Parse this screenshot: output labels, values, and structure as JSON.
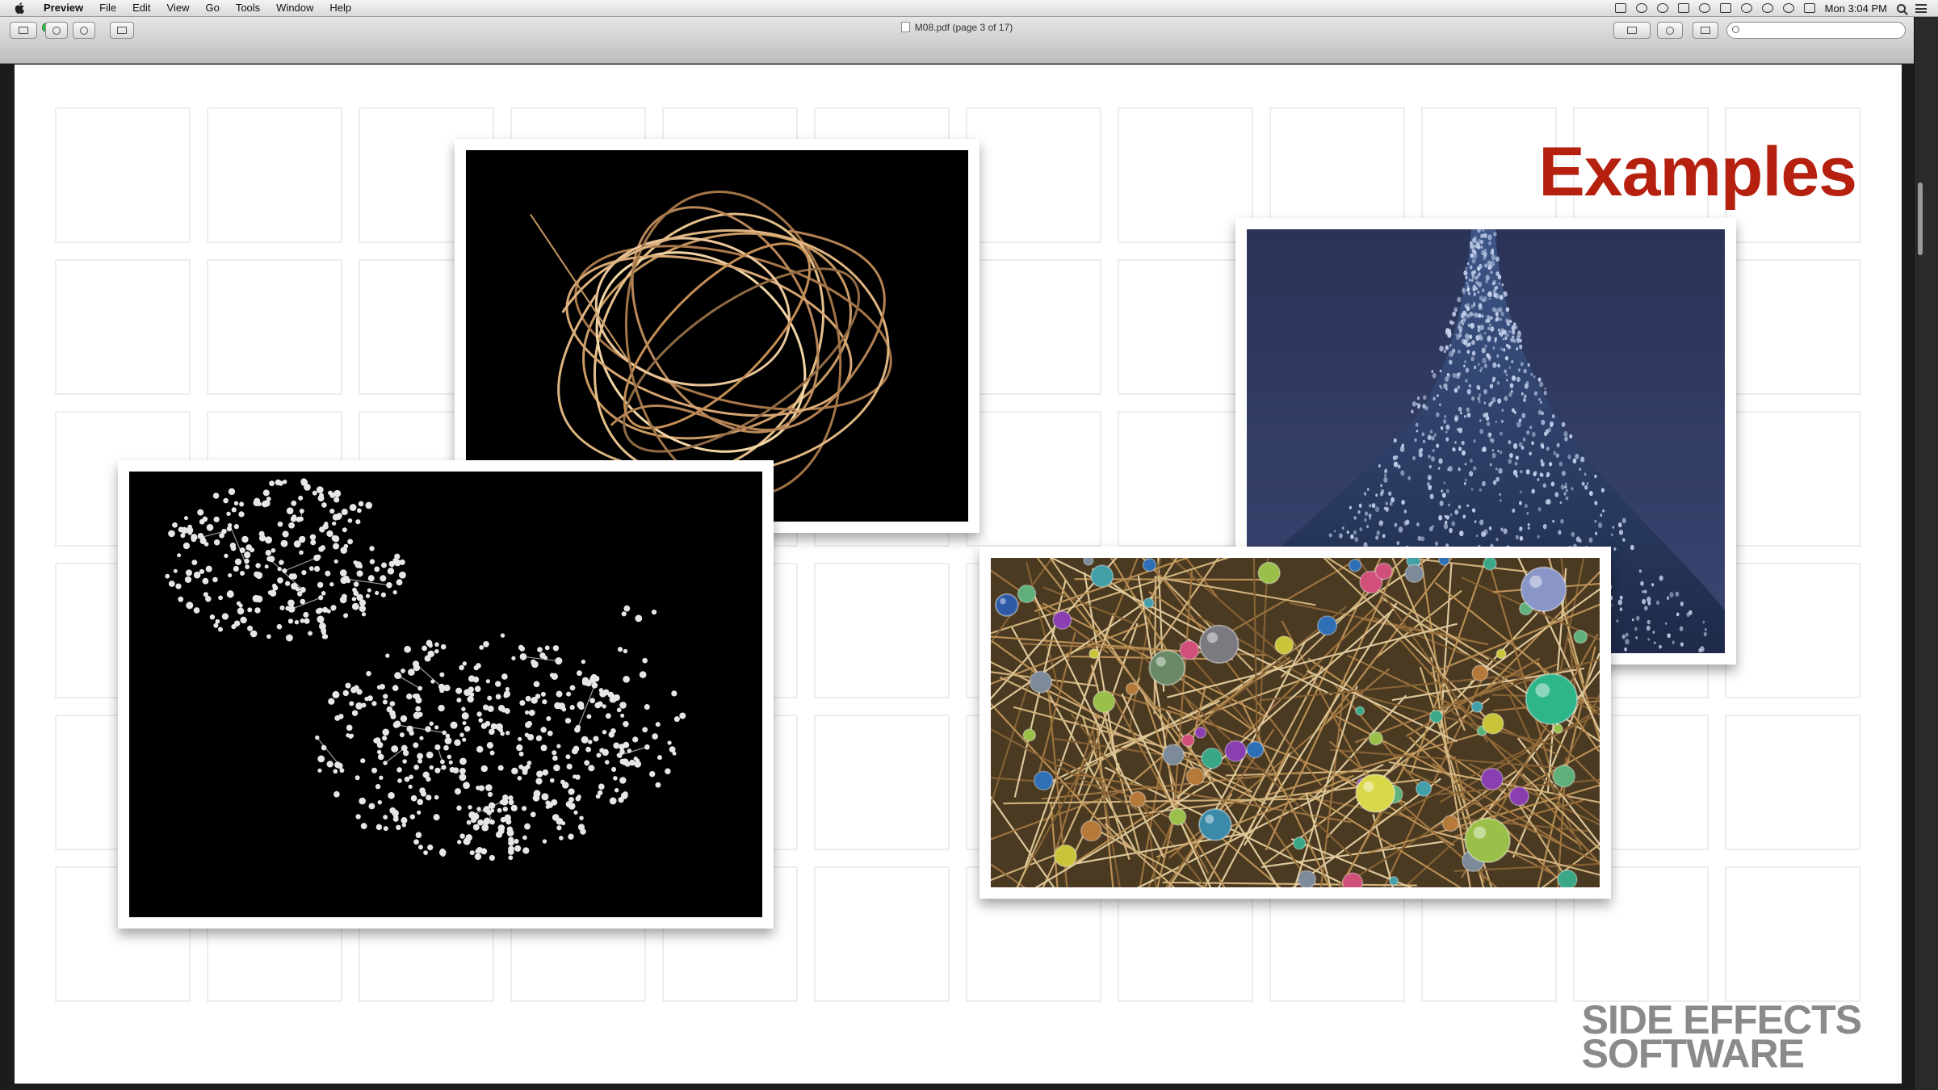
{
  "menubar": {
    "app_name": "Preview",
    "items": [
      "File",
      "Edit",
      "View",
      "Go",
      "Tools",
      "Window",
      "Help"
    ],
    "clock": "Mon 3:04 PM"
  },
  "window": {
    "title": "M08.pdf (page 3 of 17)",
    "search_placeholder": ""
  },
  "slide": {
    "title": "Examples",
    "brand_line1": "SIDE EFFECTS",
    "brand_line2": "SOFTWARE",
    "images": [
      {
        "name": "tangled-ribbons-image",
        "subject": "tangled copper ribbons"
      },
      {
        "name": "particle-cone-image",
        "subject": "blue particle cone"
      },
      {
        "name": "node-network-image",
        "subject": "white node network"
      },
      {
        "name": "colored-spheres-image",
        "subject": "colored spheres with sticks"
      }
    ]
  },
  "colors": {
    "title": "#b5200f",
    "brand": "#8a8a8a"
  }
}
